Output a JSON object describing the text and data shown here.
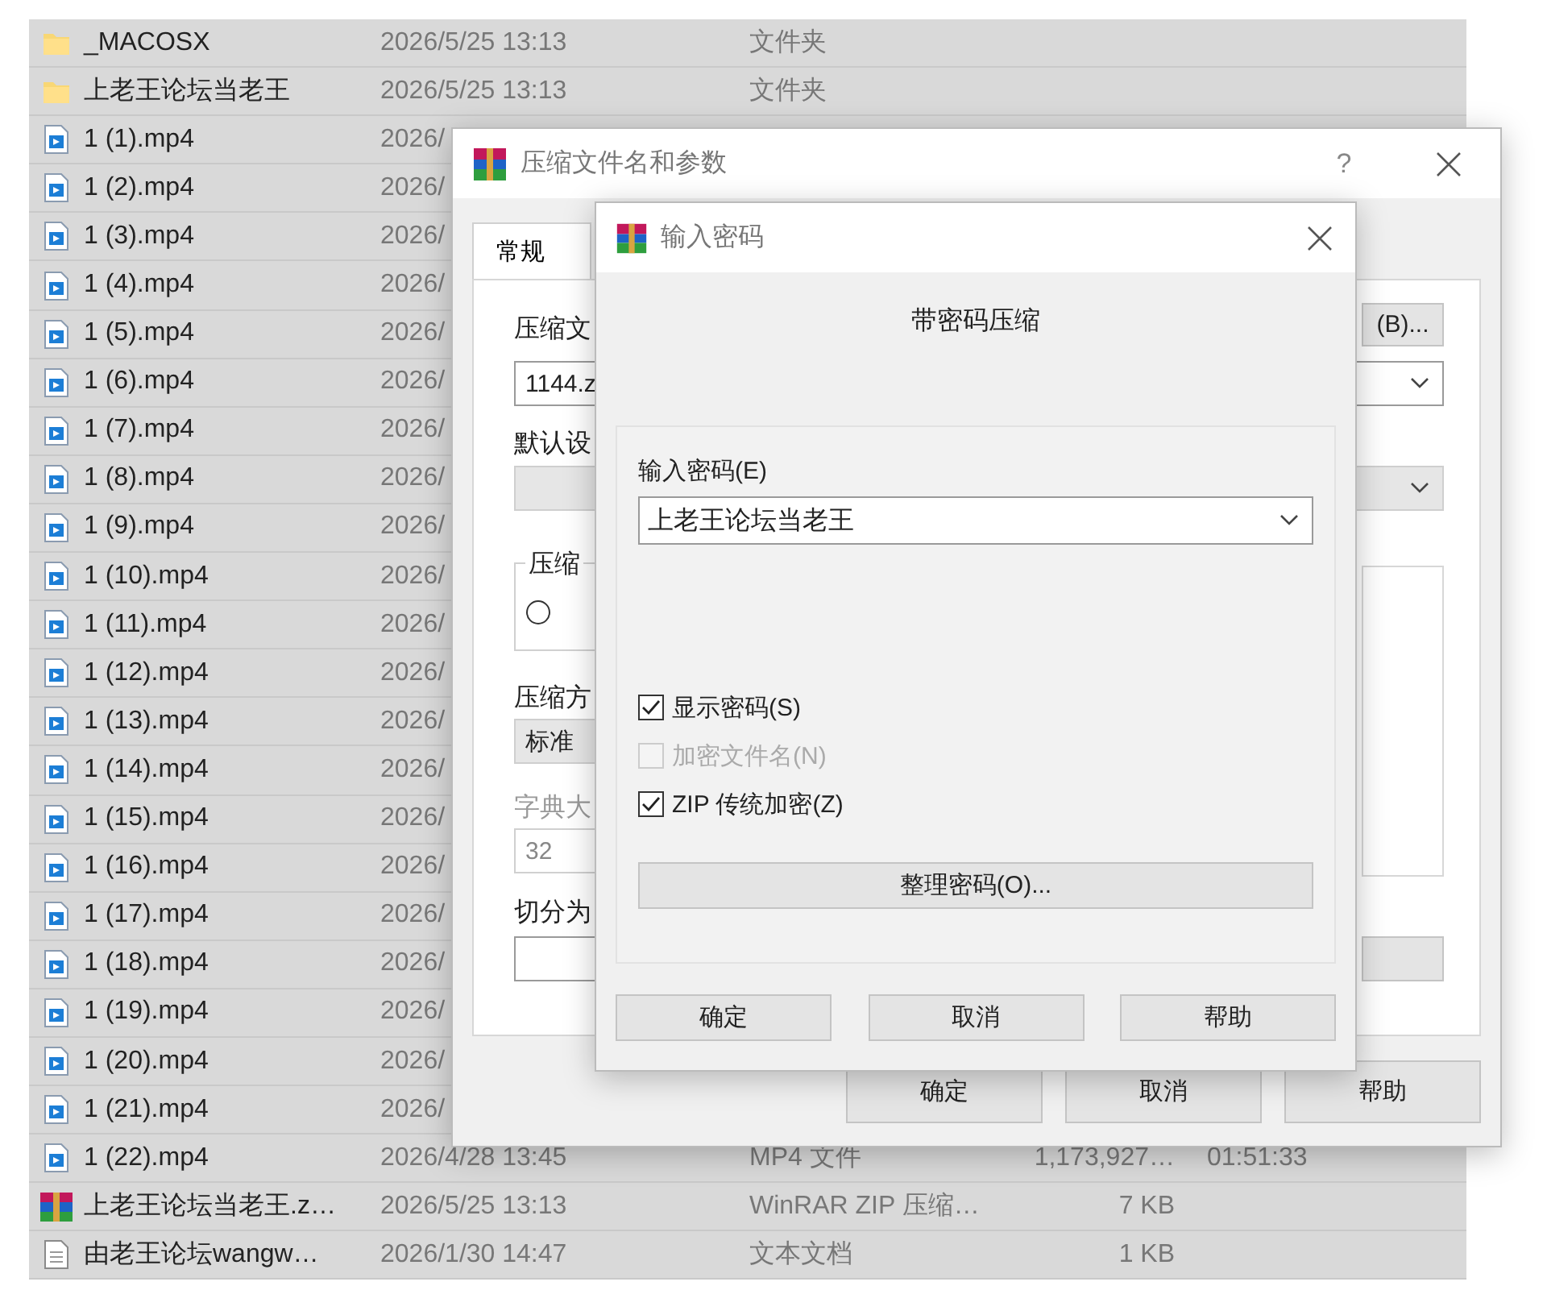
{
  "file_list": {
    "rows": [
      {
        "kind": "folder",
        "name": "_MACOSX",
        "date": "2026/5/25 13:13",
        "type": "文件夹"
      },
      {
        "kind": "folder",
        "name": "上老王论坛当老王",
        "date": "2026/5/25 13:13",
        "type": "文件夹"
      },
      {
        "kind": "video",
        "name": "1 (1).mp4",
        "date": "2026/"
      },
      {
        "kind": "video",
        "name": "1 (2).mp4",
        "date": "2026/"
      },
      {
        "kind": "video",
        "name": "1 (3).mp4",
        "date": "2026/"
      },
      {
        "kind": "video",
        "name": "1 (4).mp4",
        "date": "2026/"
      },
      {
        "kind": "video",
        "name": "1 (5).mp4",
        "date": "2026/"
      },
      {
        "kind": "video",
        "name": "1 (6).mp4",
        "date": "2026/"
      },
      {
        "kind": "video",
        "name": "1 (7).mp4",
        "date": "2026/"
      },
      {
        "kind": "video",
        "name": "1 (8).mp4",
        "date": "2026/"
      },
      {
        "kind": "video",
        "name": "1 (9).mp4",
        "date": "2026/"
      },
      {
        "kind": "video",
        "name": "1 (10).mp4",
        "date": "2026/"
      },
      {
        "kind": "video",
        "name": "1 (11).mp4",
        "date": "2026/"
      },
      {
        "kind": "video",
        "name": "1 (12).mp4",
        "date": "2026/"
      },
      {
        "kind": "video",
        "name": "1 (13).mp4",
        "date": "2026/"
      },
      {
        "kind": "video",
        "name": "1 (14).mp4",
        "date": "2026/"
      },
      {
        "kind": "video",
        "name": "1 (15).mp4",
        "date": "2026/"
      },
      {
        "kind": "video",
        "name": "1 (16).mp4",
        "date": "2026/"
      },
      {
        "kind": "video",
        "name": "1 (17).mp4",
        "date": "2026/"
      },
      {
        "kind": "video",
        "name": "1 (18).mp4",
        "date": "2026/"
      },
      {
        "kind": "video",
        "name": "1 (19).mp4",
        "date": "2026/"
      },
      {
        "kind": "video",
        "name": "1 (20).mp4",
        "date": "2026/"
      },
      {
        "kind": "video",
        "name": "1 (21).mp4",
        "date": "2026/"
      },
      {
        "kind": "video",
        "name": "1 (22).mp4",
        "date": "2026/4/28 13:45",
        "type": "MP4 文件",
        "size": "1,173,927…",
        "duration": "01:51:33"
      },
      {
        "kind": "archive",
        "name": "上老王论坛当老王.z…",
        "date": "2026/5/25 13:13",
        "type": "WinRAR ZIP 压缩…",
        "size": "7 KB"
      },
      {
        "kind": "text",
        "name": "由老王论坛wangw…",
        "date": "2026/1/30 14:47",
        "type": "文本文档",
        "size": "1 KB"
      }
    ]
  },
  "compress_dialog": {
    "title": "压缩文件名和参数",
    "help": "?",
    "tabs": [
      {
        "label": "常规",
        "selected": true
      }
    ],
    "archive_name_label": "压缩文",
    "archive_name": "1144.z",
    "browse_button": "(B)...",
    "profile_label": "默认设",
    "format_group": "压缩",
    "format_radio": {
      "selected": false
    },
    "method_label": "压缩方",
    "method": "标准",
    "dictionary_label": "字典大",
    "dictionary": "32",
    "split_label": "切分为",
    "buttons": [
      "确定",
      "取消",
      "帮助"
    ]
  },
  "password_dialog": {
    "title": "输入密码",
    "heading": "带密码压缩",
    "password_label": "输入密码(E)",
    "password": "上老王论坛当老王",
    "options": [
      {
        "label": "显示密码(S)",
        "checked": true,
        "disabled": false
      },
      {
        "label": "加密文件名(N)",
        "checked": false,
        "disabled": true
      },
      {
        "label": "ZIP 传统加密(Z)",
        "checked": true,
        "disabled": false
      }
    ],
    "organize_button": "整理密码(O)...",
    "buttons": [
      "确定",
      "取消",
      "帮助"
    ]
  }
}
